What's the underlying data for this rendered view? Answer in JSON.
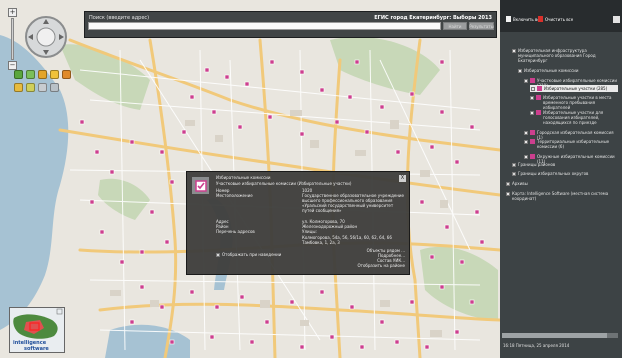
{
  "header": {
    "search_label": "Поиск (введите адрес)",
    "search_value": "",
    "app_title": "ЕГИС город Екатеринбург: Выборы 2013",
    "find_button": "Найти",
    "results_button": "Результаты"
  },
  "popup": {
    "kind": "Избирательные комиссии",
    "subkind": "Участковые избирательные комиссии (Избирательные участки)",
    "close": "X",
    "fields": [
      {
        "label": "Номер",
        "value": "1020"
      },
      {
        "label": "Местоположение",
        "value": "Государственное образовательное учреждение высшего профессионального образования «Уральский государственный университет путей сообщения»"
      },
      {
        "label": "Адрес",
        "value": "ул. Колмогорова, 70"
      },
      {
        "label": "Район",
        "value": "Железнодорожный район"
      },
      {
        "label": "Перечень адресов",
        "value": "Улицы:"
      },
      {
        "label": "",
        "value": "Колмогорова, 54а, 56, 56/1а, 60, 62, 64, 66"
      },
      {
        "label": "",
        "value": "Тамбовка, 1, 2а, 3"
      }
    ],
    "show_on_hover": "Отображать при наведении",
    "links": [
      "Объекты рядом ...",
      "Подробнее...",
      "Состав УИК...",
      "Отобразить на районе"
    ]
  },
  "sidebar": {
    "toggle_all": "Включить все",
    "clear_all": "Очистить все",
    "tree": [
      {
        "label": "Избирательная инфраструктура муниципального образования Город Екатеринбург",
        "level": 0,
        "checked": true
      },
      {
        "label": "Избирательные комиссии",
        "level": 1,
        "checked": true
      },
      {
        "label": "Участковые избирательные комиссии (319)",
        "level": 2,
        "checked": true
      },
      {
        "label": "Избирательные участки (285)",
        "level": 3,
        "checked": true,
        "selected": true
      },
      {
        "label": "Избирательные участки в места временного пребывания избирателей",
        "level": 3,
        "checked": true
      },
      {
        "label": "Избирательные участки для голосования избирателей, находящихся по приезде",
        "level": 3,
        "checked": true
      },
      {
        "label": "Городская избирательная комиссия (1)",
        "level": 2,
        "checked": true
      },
      {
        "label": "Территориальные избирательные комиссии (6)",
        "level": 2,
        "checked": true
      },
      {
        "label": "Окружные избирательные комиссии (11)",
        "level": 2,
        "checked": true
      },
      {
        "label": "Границы районов",
        "level": 1,
        "checked": false
      },
      {
        "label": "Границы избирательных округов",
        "level": 1,
        "checked": false
      },
      {
        "label": "Архивы",
        "level": 0,
        "checked": false
      },
      {
        "label": "Карта: Intelligence Software (местная система координат)",
        "level": 0,
        "checked": true
      }
    ]
  },
  "status": "16:18 Пятница, 25 апреля 2014",
  "minimap": {
    "logo_line1": "intelligence",
    "logo_line2": "software"
  },
  "colors": {
    "accent_pink": "#cc3f8e",
    "panel": "#3d4345",
    "popup_bg": "#3e3e3c"
  }
}
